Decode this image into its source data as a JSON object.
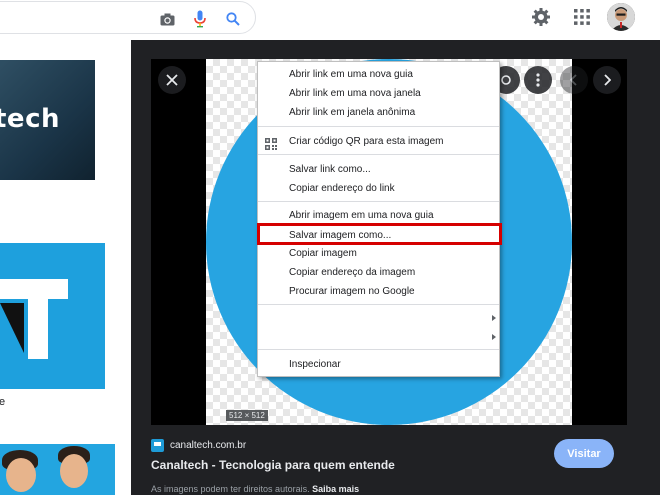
{
  "viewer": {
    "image_dimensions": "512 × 512",
    "site": "canaltech.com.br",
    "title": "Canaltech - Tecnologia para quem entende",
    "copyright_text": "As imagens podem ter direitos autorais.",
    "learn_more": "Saiba mais",
    "visit_button": "Visitar"
  },
  "left_results": {
    "thumb1_text": "tech",
    "snippet_fragment": "e"
  },
  "context_menu": {
    "items": [
      "Abrir link em uma nova guia",
      "Abrir link em uma nova janela",
      "Abrir link em janela anônima",
      "Criar código QR para esta imagem",
      "Salvar link como...",
      "Copiar endereço do link",
      "Abrir imagem em uma nova guia",
      "Salvar imagem como...",
      "Copiar imagem",
      "Copiar endereço da imagem",
      "Procurar imagem no Google",
      "Inspecionar"
    ],
    "highlighted_item": "Salvar imagem como..."
  },
  "icons": {
    "search_bar": [
      "camera-icon",
      "microphone-icon",
      "search-icon"
    ],
    "top_right": [
      "settings-icon",
      "apps-grid-icon",
      "avatar"
    ],
    "viewer_controls": [
      "close-icon",
      "share-icon",
      "more-icon",
      "previous-icon",
      "next-icon"
    ]
  },
  "colors": {
    "viewer_bg": "#202124",
    "image_circle": "#27a4e1",
    "highlight_box": "#d50000",
    "visit_button": "#8ab4f8"
  }
}
